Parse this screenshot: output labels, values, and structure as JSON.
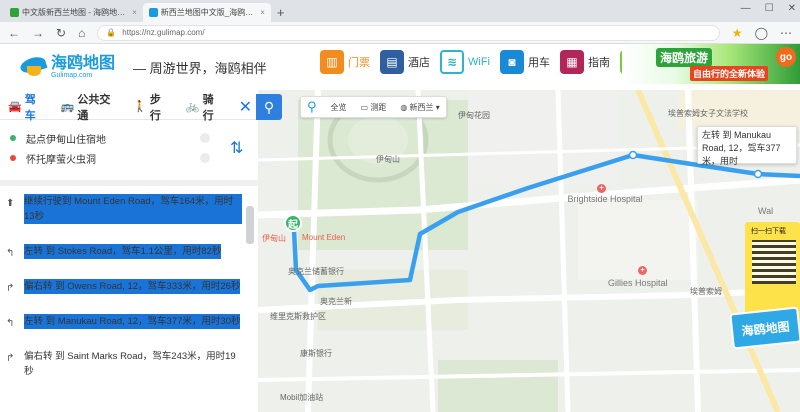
{
  "browser": {
    "tabs": [
      {
        "title": "中文版新西兰地图 - 海鸥地…",
        "active": false,
        "color": "#2ea33a"
      },
      {
        "title": "新西兰地图中文版_海鸥…",
        "active": true,
        "color": "#1a9be0"
      }
    ],
    "url": "https://nz.gulimap.com/",
    "new_tab_symbol": "+"
  },
  "header": {
    "logo_cn": "海鸥地图",
    "logo_en": "Gulimap.com",
    "slogan": "— 周游世界，海鸥相伴",
    "categories": [
      {
        "label": "门票",
        "icon": "ticket-icon",
        "color": "#f28c1e",
        "glyph": "▥"
      },
      {
        "label": "酒店",
        "icon": "hotel-icon",
        "color": "#2f5f9e",
        "glyph": "▤"
      },
      {
        "label": "WiFi",
        "icon": "wifi-icon",
        "color": "#2bb5c8",
        "glyph": "≋"
      },
      {
        "label": "用车",
        "icon": "car-icon",
        "color": "#1b8ad6",
        "glyph": "◙"
      },
      {
        "label": "指南",
        "icon": "guide-icon",
        "color": "#b3265a",
        "glyph": "▦"
      },
      {
        "label": "",
        "icon": "star-icon",
        "color": "#7ac943",
        "glyph": "☆"
      }
    ],
    "banner": {
      "title": "海鸥旅游",
      "subtitle": "自由行的全新体验",
      "go": "go"
    }
  },
  "route_panel": {
    "modes": [
      {
        "label": "驾车",
        "icon": "car-icon",
        "active": true
      },
      {
        "label": "公共交通",
        "icon": "bus-icon",
        "active": false
      },
      {
        "label": "步行",
        "icon": "walk-icon",
        "active": false
      },
      {
        "label": "骑行",
        "icon": "bike-icon",
        "active": false
      }
    ],
    "start": "起点伊甸山住宿地",
    "end": "怀托摩萤火虫洞",
    "steps": [
      {
        "text": "继续行驶到 Mount Eden Road，驾车164米，用时13秒",
        "highlighted": true
      },
      {
        "text": "左转 到 Stokes Road，驾车1.1公里，用时82秒",
        "highlighted": true
      },
      {
        "text": "偏右转 到 Owens Road, 12，驾车333米，用时26秒",
        "highlighted": true
      },
      {
        "text": "左转 到 Manukau Road, 12，驾车377米，用时30秒",
        "highlighted": true
      },
      {
        "text": "偏右转 到 Saint Marks Road，驾车243米，用时19秒",
        "highlighted": false
      }
    ]
  },
  "map": {
    "toolbar": [
      {
        "label": "全览",
        "icon": "overview-icon"
      },
      {
        "label": "测距",
        "icon": "ruler-icon"
      },
      {
        "label": "新西兰",
        "icon": "globe-icon"
      }
    ],
    "labels": [
      {
        "text": "伊甸花园"
      },
      {
        "text": "伊甸山"
      },
      {
        "text": "Mount Eden"
      },
      {
        "text": "伊甸山"
      },
      {
        "text": "奥克兰储蓄银行"
      },
      {
        "text": "埃普索姆女子文法学校"
      },
      {
        "text": "Brightside Hospital"
      },
      {
        "text": "Gillies Hospital"
      },
      {
        "text": "埃普索姆"
      },
      {
        "text": "维里克斯救护区"
      },
      {
        "text": "奥克兰新"
      },
      {
        "text": "康斯银行"
      },
      {
        "text": "Mobil加油站"
      },
      {
        "text": "Wal"
      }
    ],
    "start_marker": "起",
    "tooltip": "左转 到 Manukau Road, 12，驾车377米，用时",
    "qr_title": "扫一扫下载",
    "promo": "海鸥地图",
    "route_color": "#3aa0ee"
  }
}
